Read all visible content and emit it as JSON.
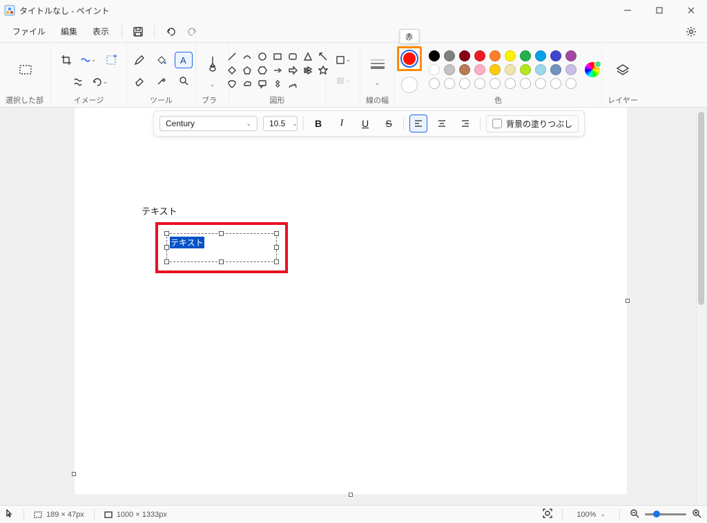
{
  "title": "タイトルなし - ペイント",
  "menu": {
    "file": "ファイル",
    "edit": "編集",
    "view": "表示"
  },
  "ribbon": {
    "selection": "選択した部分",
    "image": "イメージ",
    "tools": "ツール",
    "brush": "ブラシ",
    "shapes": "図形",
    "stroke": "線の幅",
    "colors": "色",
    "layers": "レイヤー"
  },
  "tooltip_red": "赤",
  "text_toolbar": {
    "font": "Century",
    "size": "10.5",
    "fill_bg_label": "背景の塗りつぶし"
  },
  "palette_row1": [
    "#000000",
    "#7f7f7f",
    "#880015",
    "#ed1c24",
    "#ff7f27",
    "#fff200",
    "#22b14c",
    "#00a2e8",
    "#3f48cc",
    "#a349a4"
  ],
  "palette_row2": [
    "#ffffff",
    "#c3c3c3",
    "#b97a57",
    "#ffaec9",
    "#ffc90e",
    "#efe4b0",
    "#b5e61d",
    "#99d9ea",
    "#7092be",
    "#c8bfe7"
  ],
  "canvas_text": "テキスト",
  "textbox_value": "テキスト",
  "status": {
    "cursor_mode": "",
    "selection": "189 × 47px",
    "canvas": "1000 × 1333px",
    "zoom": "100%"
  }
}
